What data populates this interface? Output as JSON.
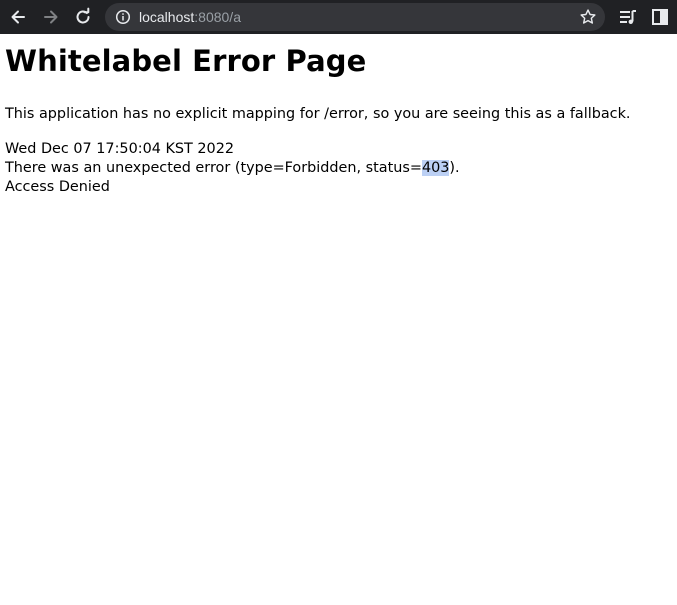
{
  "browser": {
    "url_host": "localhost",
    "url_rest": ":8080/a",
    "icons": {
      "back": "arrow-left-icon",
      "forward": "arrow-right-icon",
      "reload": "reload-icon",
      "info": "info-icon",
      "bookmark": "star-icon",
      "reading_list": "reading-list-icon",
      "side_panel": "side-panel-icon"
    },
    "colors": {
      "toolbar_bg": "#202124",
      "omnibox_bg": "#35363a",
      "host_text": "#e8eaed",
      "path_text": "#9aa0a6"
    }
  },
  "page": {
    "title": "Whitelabel Error Page",
    "description": "This application has no explicit mapping for /error, so you are seeing this as a fallback.",
    "timestamp": "Wed Dec 07 17:50:04 KST 2022",
    "error_prefix": "There was an unexpected error (type=Forbidden, status=",
    "error_status": "403",
    "error_suffix": ").",
    "message": "Access Denied",
    "selection_color": "#bcd0f4"
  }
}
